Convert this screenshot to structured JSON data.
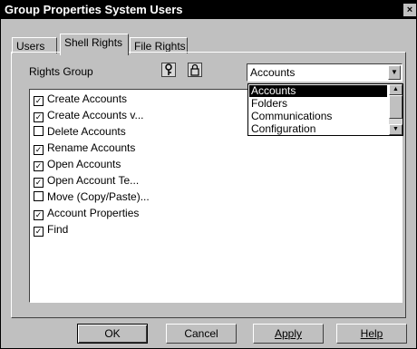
{
  "window": {
    "title": "Group Properties System Users",
    "close_label": "×"
  },
  "tabs": [
    {
      "label": "Users",
      "active": false
    },
    {
      "label": "Shell Rights",
      "active": true
    },
    {
      "label": "File Rights",
      "active": false
    }
  ],
  "rights_group": {
    "label": "Rights Group",
    "icons": [
      "key-icon",
      "lock-icon"
    ],
    "selected": "Accounts",
    "options": [
      "Accounts",
      "Folders",
      "Communications",
      "Configuration"
    ]
  },
  "rights": [
    {
      "label": "Create Accounts",
      "checked": true
    },
    {
      "label": "Create Accounts v...",
      "checked": true
    },
    {
      "label": "Delete Accounts",
      "checked": false
    },
    {
      "label": "Rename Accounts",
      "checked": true
    },
    {
      "label": "Open Accounts",
      "checked": true
    },
    {
      "label": "Open Account Te...",
      "checked": true
    },
    {
      "label": "Move (Copy/Paste)...",
      "checked": false
    },
    {
      "label": "Account Properties",
      "checked": true
    },
    {
      "label": "Find",
      "checked": true
    }
  ],
  "buttons": {
    "ok": "OK",
    "cancel": "Cancel",
    "apply": "Apply",
    "help": "Help"
  }
}
